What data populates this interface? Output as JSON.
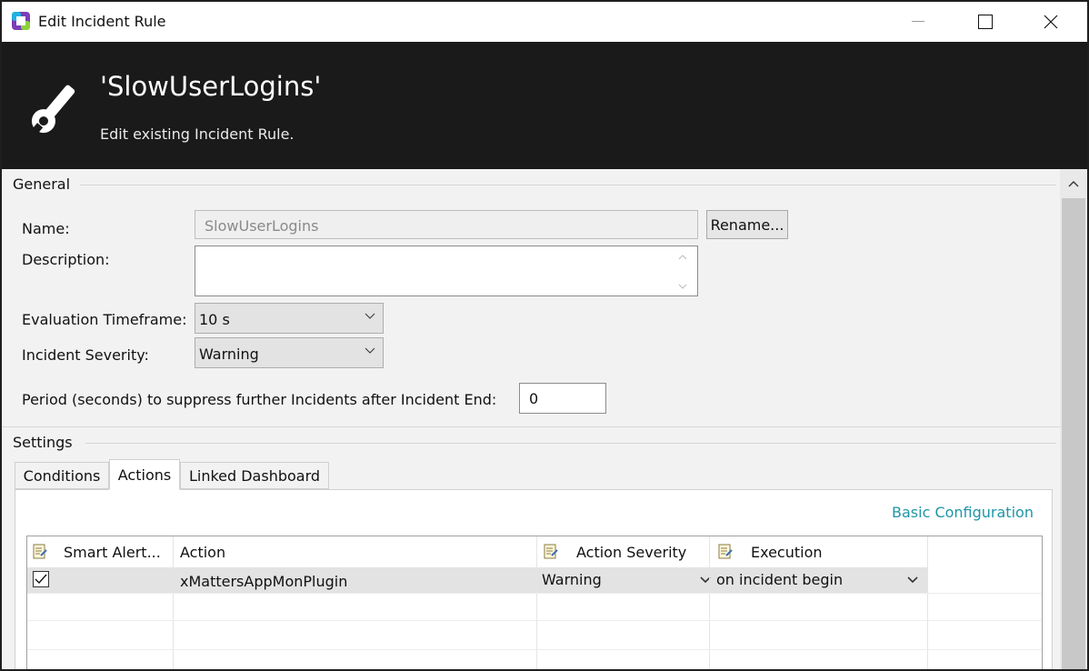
{
  "window": {
    "title": "Edit Incident Rule",
    "controls": {
      "minimize": "minimize",
      "maximize": "maximize",
      "close": "close"
    }
  },
  "header": {
    "title": "'SlowUserLogins'",
    "subtitle": "Edit existing Incident Rule.",
    "icon": "wrench-icon"
  },
  "general": {
    "title": "General",
    "name_label": "Name:",
    "name_value": "SlowUserLogins",
    "rename_label": "Rename...",
    "description_label": "Description:",
    "description_value": "",
    "timeframe_label": "Evaluation Timeframe:",
    "timeframe_value": "10 s",
    "severity_label": "Incident Severity:",
    "severity_value": "Warning",
    "suppress_label": "Period (seconds) to suppress further Incidents after Incident End:",
    "suppress_value": "0"
  },
  "settings": {
    "title": "Settings",
    "tabs": [
      {
        "label": "Conditions",
        "active": false
      },
      {
        "label": "Actions",
        "active": true
      },
      {
        "label": "Linked Dashboard",
        "active": false
      }
    ],
    "basic_config_link": "Basic Configuration",
    "table": {
      "columns": [
        "Smart Alert...",
        "Action",
        "Action Severity",
        "Execution"
      ],
      "rows": [
        {
          "checked": true,
          "action": "xMattersAppMonPlugin",
          "severity": "Warning",
          "execution": "on incident begin"
        }
      ]
    }
  },
  "colors": {
    "header_bg": "#1a1a1a",
    "link": "#1f96a6",
    "selected_row": "#e3e3e3"
  }
}
